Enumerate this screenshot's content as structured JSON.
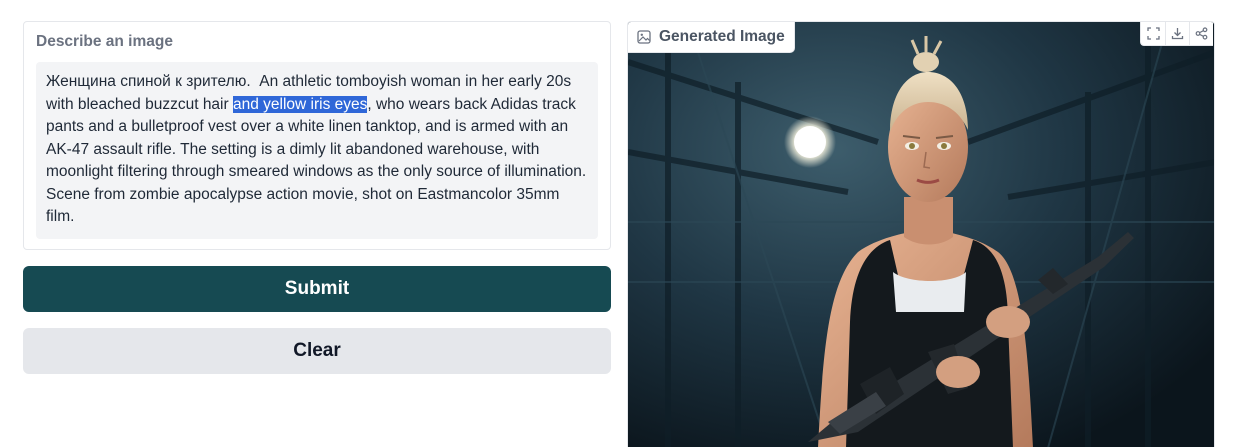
{
  "input": {
    "label": "Describe an image",
    "text_before": "Женщина спиной к зрителю.  An athletic tomboyish woman in her early 20s with bleached buzzcut hair ",
    "text_selected": "and yellow iris eyes",
    "text_after": ", who wears back Adidas track pants and a bulletproof vest over a white linen tanktop, and is armed with an AK-47 assault rifle. The setting is a dimly lit abandoned warehouse, with moonlight filtering through smeared windows as the only source of illumination. Scene from zombie apocalypse action movie, shot on Eastmancolor 35mm film."
  },
  "buttons": {
    "submit": "Submit",
    "clear": "Clear"
  },
  "output": {
    "label": "Generated Image",
    "label_icon": "image-icon",
    "toolbar_icons": [
      "fullscreen-icon",
      "download-icon",
      "share-icon"
    ]
  },
  "colors": {
    "submit_bg": "#164a52",
    "clear_bg": "#e5e7eb",
    "selection": "#2f67d8"
  }
}
